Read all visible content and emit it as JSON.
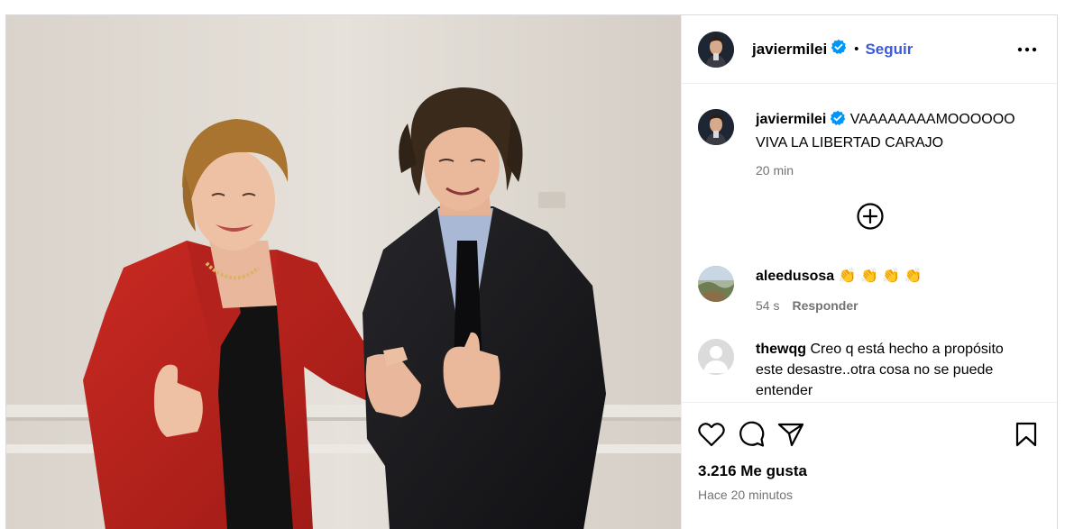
{
  "post": {
    "author": "javiermilei",
    "follow_label": "Seguir",
    "separator": "•",
    "caption": {
      "author": "javiermilei",
      "text_line1": "VAAAAAAAAMOOOOOO",
      "text_line2": "VIVA LA LIBERTAD CARAJO",
      "time": "20 min"
    },
    "comments": [
      {
        "username": "aleedusosa",
        "text": "👏 👏 👏 👏",
        "time": "54 s",
        "reply_label": "Responder"
      },
      {
        "username": "thewqg",
        "text_line1": "Creo q está hecho a propósito",
        "text_line2": "este desastre..otra cosa no se puede",
        "text_line3": "entender"
      }
    ],
    "likes": "3.216 Me gusta",
    "posted": "Hace 20 minutos"
  },
  "colors": {
    "follow_blue": "#3b5bdb",
    "verified_blue": "#0095f6",
    "muted_text": "#737373",
    "border": "#dbdbdb"
  },
  "icons": [
    "verified-badge-icon",
    "more-options-icon",
    "load-more-comments-icon",
    "like-heart-icon",
    "comment-bubble-icon",
    "share-send-icon",
    "save-bookmark-icon"
  ]
}
